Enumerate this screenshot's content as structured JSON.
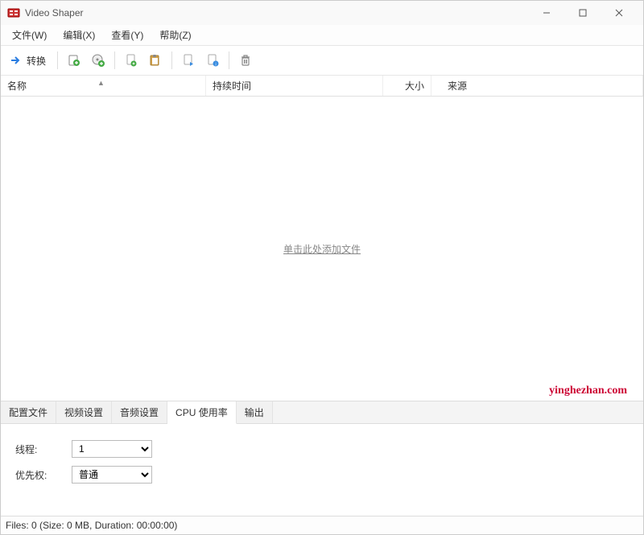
{
  "window": {
    "title": "Video Shaper"
  },
  "menu": {
    "file": "文件(W)",
    "edit": "编辑(X)",
    "view": "查看(Y)",
    "help": "帮助(Z)"
  },
  "toolbar": {
    "convert": "转换"
  },
  "columns": {
    "name": "名称",
    "duration": "持续时间",
    "size": "大小",
    "source": "来源"
  },
  "empty_hint": "单击此处添加文件",
  "watermark": "yinghezhan.com",
  "tabs": {
    "profile": "配置文件",
    "video": "视频设置",
    "audio": "音频设置",
    "cpu": "CPU 使用率",
    "output": "输出"
  },
  "cpu_panel": {
    "threads_label": "线程:",
    "threads_value": "1",
    "priority_label": "优先权:",
    "priority_value": "普通"
  },
  "status": "Files: 0 (Size: 0 MB, Duration: 00:00:00)"
}
